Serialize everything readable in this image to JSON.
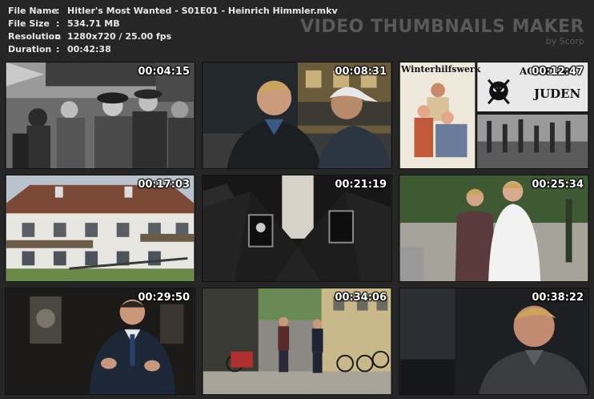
{
  "file_info": [
    {
      "key": "File Name",
      "value": "Hitler's Most Wanted - S01E01 - Heinrich Himmler.mkv"
    },
    {
      "key": "File Size",
      "value": "534.71 MB"
    },
    {
      "key": "Resolution",
      "value": "1280x720 / 25.00 fps"
    },
    {
      "key": "Duration",
      "value": "00:42:38"
    }
  ],
  "separator": ":",
  "brand": {
    "title": "VIDEO THUMBNAILS MAKER",
    "subtitle": "by Scorp"
  },
  "thumbnails": [
    {
      "timestamp": "00:04:15"
    },
    {
      "timestamp": "00:08:31"
    },
    {
      "timestamp": "00:12:47",
      "poster_text": "Winterhilfswerk",
      "sign_text_1": "ACHTUNG",
      "sign_text_2": "JUDEN"
    },
    {
      "timestamp": "00:17:03"
    },
    {
      "timestamp": "00:21:19"
    },
    {
      "timestamp": "00:25:34"
    },
    {
      "timestamp": "00:29:50"
    },
    {
      "timestamp": "00:34:06"
    },
    {
      "timestamp": "00:38:22"
    }
  ]
}
